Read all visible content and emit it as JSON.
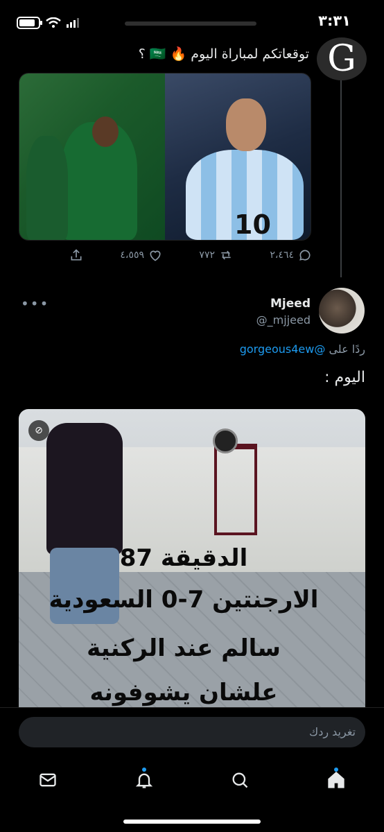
{
  "status_bar": {
    "time": "٣:٣١"
  },
  "quoted_tweet": {
    "avatar_letter": "G",
    "text": "توقعاتكم لمباراة اليوم 🔥 🇸🇦 ؟",
    "actions": {
      "replies": "٢،٤٦٤",
      "retweets": "٧٧٢",
      "likes": "٤،٥٥٩"
    }
  },
  "reply_tweet": {
    "name": "Mjeed",
    "handle": "@_mjjeed",
    "reply_prefix": "ردًا على",
    "reply_target": "@gorgeous4ew",
    "text": "اليوم :",
    "more_label": "•••",
    "video_overlay": {
      "line1": "الدقيقة 87",
      "line2": "الارجنتين 7-0 السعودية",
      "line3": "سالم عند الركنية",
      "line4": "علشان يشوفونه"
    }
  },
  "composer": {
    "placeholder": "تغريد ردك"
  },
  "bottom_nav": {
    "items": [
      {
        "name": "messages",
        "icon": "mail-icon"
      },
      {
        "name": "notifications",
        "icon": "bell-icon",
        "has_dot": true
      },
      {
        "name": "search",
        "icon": "search-icon"
      },
      {
        "name": "home",
        "icon": "home-icon",
        "has_dot": true
      }
    ]
  },
  "colors": {
    "accent": "#1d9bf0",
    "background": "#000000",
    "muted": "#8b98a5",
    "text": "#e7e9ea"
  }
}
